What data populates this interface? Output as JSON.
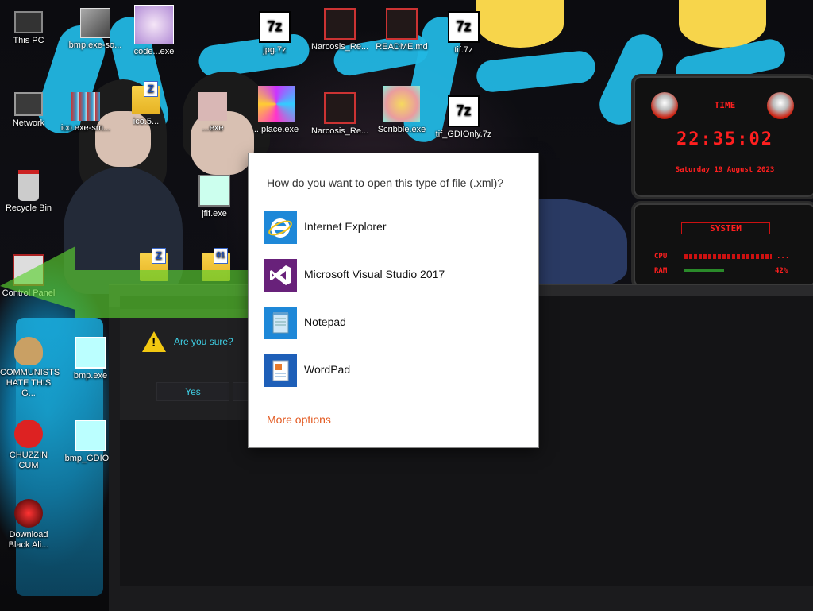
{
  "desktop": {
    "icons": [
      {
        "label": "This PC"
      },
      {
        "label": "bmp.exe-so..."
      },
      {
        "label": "code...exe"
      },
      {
        "label": "jpg.7z"
      },
      {
        "label": "Narcosis_Re..."
      },
      {
        "label": "README.md"
      },
      {
        "label": "tif.7z"
      },
      {
        "label": "Network"
      },
      {
        "label": "ico.exe-sm..."
      },
      {
        "label": "ico.5..."
      },
      {
        "label": "...exe"
      },
      {
        "label": "...place.exe"
      },
      {
        "label": "Narcosis_Re..."
      },
      {
        "label": "Scribble.exe"
      },
      {
        "label": "tif_GDIOnly.7z"
      },
      {
        "label": "Recycle Bin"
      },
      {
        "label": "jfif.exe"
      },
      {
        "label": "Control Panel"
      },
      {
        "label": "COMMUNISTS HATE THIS G..."
      },
      {
        "label": "bmp.exe"
      },
      {
        "label": "CHUZZIN CUM"
      },
      {
        "label": "bmp_GDIO..."
      },
      {
        "label": "Download Black Ali..."
      }
    ],
    "seven_zip_glyph": "7z",
    "folder_badge_z": "Z",
    "folder_badge_01": "01"
  },
  "widget": {
    "time_title": "TIME",
    "time": "22:35:02",
    "date": "Saturday 19 August 2023",
    "system_title": "SYSTEM",
    "cpu_label": "CPU",
    "cpu_value": "...",
    "ram_label": "RAM",
    "ram_value": "42%"
  },
  "confirm_window": {
    "message": "Are you sure?",
    "yes_label": "Yes",
    "warning_glyph": "!"
  },
  "open_with": {
    "question": "How do you want to open this type of file (.xml)?",
    "apps": [
      {
        "name": "Internet Explorer",
        "icon": "internet-explorer-icon"
      },
      {
        "name": "Microsoft Visual Studio 2017",
        "icon": "visual-studio-icon"
      },
      {
        "name": "Notepad",
        "icon": "notepad-icon"
      },
      {
        "name": "WordPad",
        "icon": "wordpad-icon"
      }
    ],
    "more_options": "More options"
  },
  "colors": {
    "accent_orange": "#e35a21",
    "widget_red": "#ff1f1f",
    "confirm_cyan": "#3fd0e6",
    "wallpaper_cyan": "#22b7e3"
  }
}
